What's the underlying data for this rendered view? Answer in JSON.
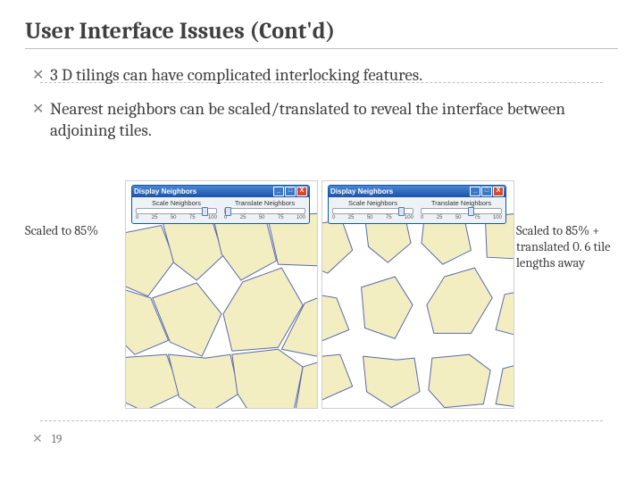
{
  "title": "User Interface Issues (Cont'd)",
  "bullets": [
    "3 D tilings can have complicated interlocking features.",
    "Nearest neighbors can be scaled/translated to reveal the interface between adjoining tiles."
  ],
  "captions": {
    "left": "Scaled to 85%",
    "right": "Scaled to 85% + translated 0. 6 tile lengths away"
  },
  "panel": {
    "window_title": "Display Neighbors",
    "scale_label": "Scale Neighbors",
    "translate_label": "Translate Neighbors",
    "ticks_scale": [
      "0",
      "25",
      "50",
      "75",
      "100"
    ],
    "ticks_trans": [
      "0",
      "25",
      "50",
      "75",
      "100"
    ]
  },
  "page_number": "19",
  "glyphs": {
    "bullet": "✕",
    "close": "X",
    "min": "_",
    "max": "□"
  },
  "colors": {
    "tile_fill": "#f2eec2",
    "tile_stroke": "#5a69a9"
  }
}
